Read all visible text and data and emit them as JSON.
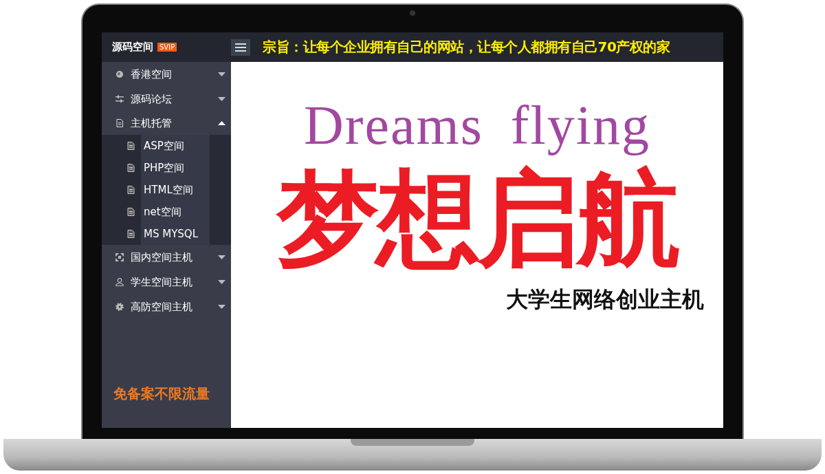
{
  "logo": {
    "title": "源码空间",
    "badge": "SVIP"
  },
  "banner": "宗旨：让每个企业拥有自己的网站，让每个人都拥有自己70产权的家",
  "menu": [
    {
      "label": "香港空间",
      "expanded": false
    },
    {
      "label": "源码论坛",
      "expanded": false
    },
    {
      "label": "主机托管",
      "expanded": true,
      "children": [
        {
          "label": "ASP空间"
        },
        {
          "label": "PHP空间"
        },
        {
          "label": "HTML空间"
        },
        {
          "label": "net空间"
        },
        {
          "label": "MS MYSQL"
        }
      ]
    },
    {
      "label": "国内空间主机",
      "expanded": false
    },
    {
      "label": "学生空间主机",
      "expanded": false
    },
    {
      "label": "高防空间主机",
      "expanded": false
    }
  ],
  "promo": "免备案不限流量",
  "hero": {
    "title_en": "Dreams flying",
    "title_zh": "梦想启航",
    "subtitle": "大学生网络创业主机"
  }
}
